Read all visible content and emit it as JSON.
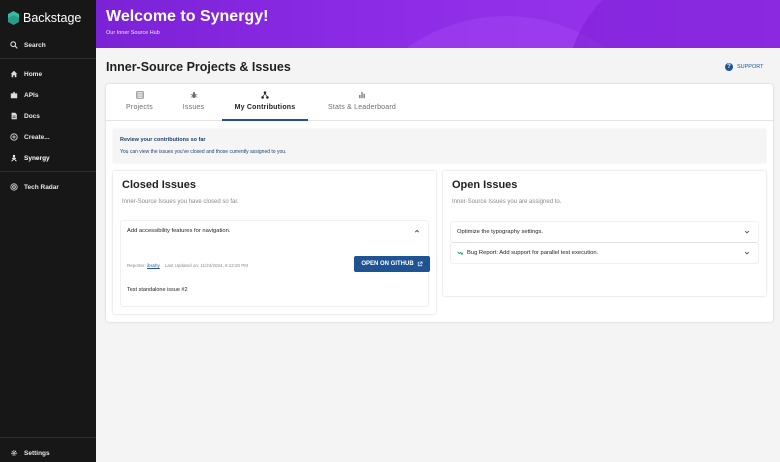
{
  "sidebar": {
    "brand": "Backstage",
    "items": [
      {
        "label": "Search",
        "icon": "search-icon"
      },
      {
        "label": "Home",
        "icon": "home-icon"
      },
      {
        "label": "APIs",
        "icon": "extension-icon"
      },
      {
        "label": "Docs",
        "icon": "docs-icon"
      },
      {
        "label": "Create...",
        "icon": "add-circle-icon"
      },
      {
        "label": "Synergy",
        "icon": "synergy-icon"
      },
      {
        "label": "Tech Radar",
        "icon": "radar-icon"
      },
      {
        "label": "Settings",
        "icon": "gear-icon"
      }
    ]
  },
  "banner": {
    "title": "Welcome to Synergy!",
    "subtitle": "Our Inner Source Hub"
  },
  "page": {
    "title": "Inner-Source Projects & Issues",
    "support_label": "SUPPORT"
  },
  "tabs": [
    {
      "label": "Projects",
      "icon": "table-icon"
    },
    {
      "label": "Issues",
      "icon": "bug-icon"
    },
    {
      "label": "My Contributions",
      "icon": "hierarchy-icon",
      "active": true
    },
    {
      "label": "Stats & Leaderboard",
      "icon": "bar-chart-icon"
    }
  ],
  "info": {
    "title": "Review your contributions so far",
    "text": "You can view the issues you've closed and those currently assigned to you."
  },
  "closed": {
    "title": "Closed Issues",
    "description": "Inner-Source Issues you have closed so far.",
    "item": {
      "title": "Add accessibility features for navigation.",
      "reporter_label": "Reporter:",
      "reporter": "ibsshy",
      "updated": "Last Updated on: 11/24/2024, 6:12:20 PM",
      "button": "OPEN ON GITHUB",
      "body": "Test standalone issue #2"
    }
  },
  "open": {
    "title": "Open Issues",
    "description": "Inner-Source Issues you are assigned to.",
    "items": [
      {
        "title": "Optimize the typography settings."
      },
      {
        "title": "Bug Report: Add support for parallel test execution."
      }
    ]
  },
  "colors": {
    "sidebar": "#171717",
    "banner": "#8c2be6",
    "accent": "#1f5493"
  }
}
